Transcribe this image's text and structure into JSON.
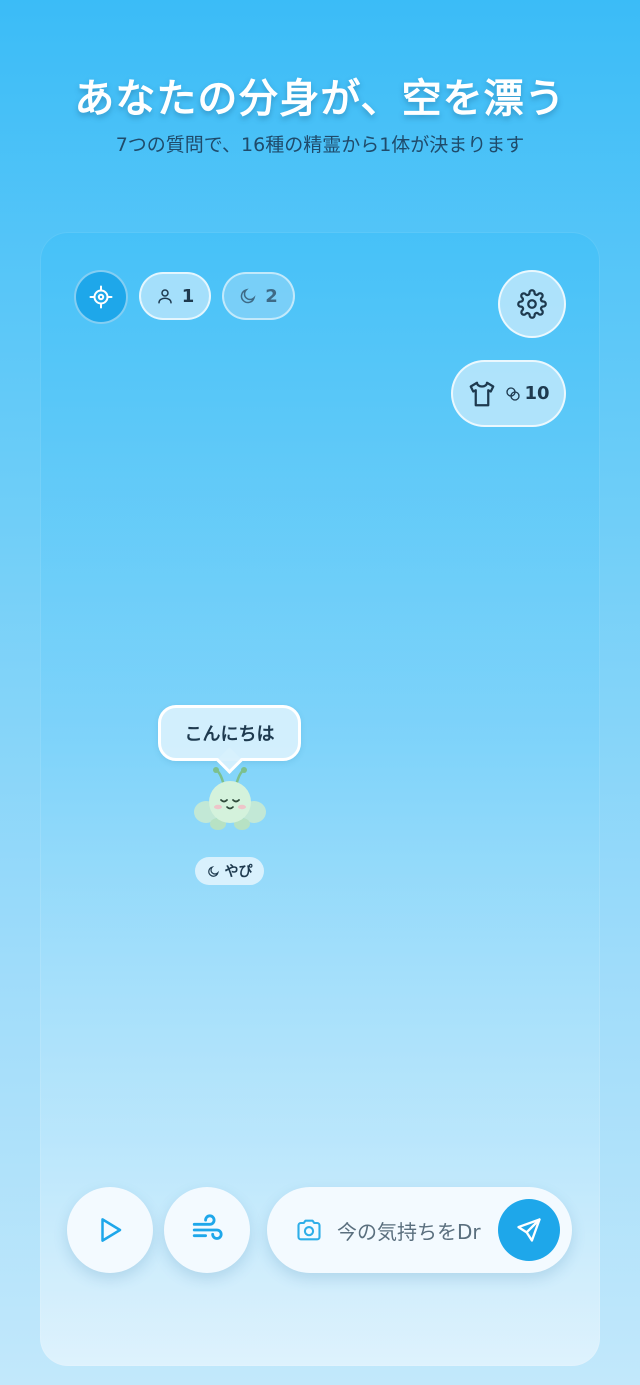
{
  "header": {
    "title": "あなたの分身が、空を漂う",
    "subtitle": "7つの質問で、16種の精霊から1体が決まります"
  },
  "toolbar": {
    "locate_icon": "crosshair-icon",
    "users_count": "1",
    "night_count": "2",
    "settings_icon": "gear-icon",
    "coin_count": "10"
  },
  "scene": {
    "speech": "こんにちは",
    "spirit_name": "やぴ"
  },
  "bottom": {
    "input_value": "今の気持ちをDr",
    "input_placeholder": "今の気持ちをDr"
  },
  "colors": {
    "accent": "#1ea7ea",
    "background_top": "#3bbcf7",
    "background_bottom": "#c2e8fb"
  }
}
